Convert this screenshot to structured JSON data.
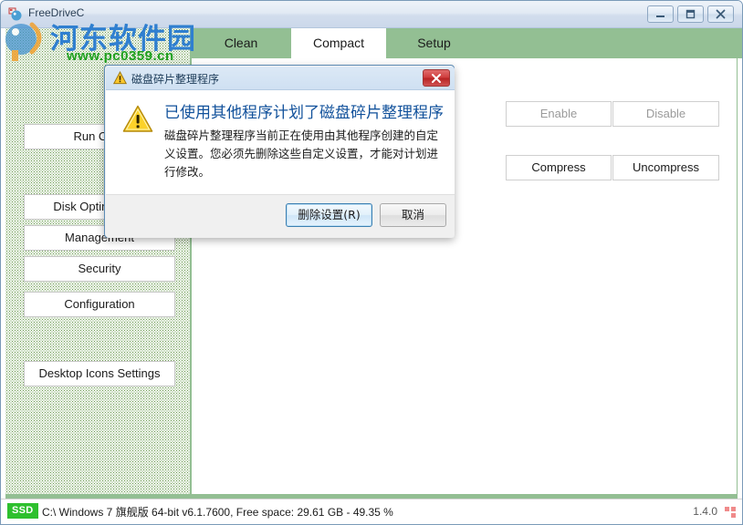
{
  "window": {
    "title": "FreeDriveC",
    "icon": "app-icon",
    "controls": {
      "minimize": "Minimize",
      "maximize": "Maximize",
      "close": "Close"
    }
  },
  "watermark": {
    "chinese": "河东软件园",
    "url": "www.pc0359.cn",
    "chinese_color": "#2f7fd0",
    "url_color": "#1ea01e"
  },
  "tabs": [
    {
      "label": "Clean",
      "active": false
    },
    {
      "label": "Compact",
      "active": true
    },
    {
      "label": "Setup",
      "active": false
    }
  ],
  "sidebar": {
    "items": [
      {
        "label": "Run CMD"
      },
      {
        "label": "Disk Optimization"
      },
      {
        "label": "Management"
      },
      {
        "label": "Security"
      },
      {
        "label": "Configuration"
      },
      {
        "label": "Desktop Icons Settings"
      }
    ]
  },
  "main": {
    "buttons": [
      {
        "label": "Enable",
        "state": "disabled"
      },
      {
        "label": "Disable",
        "state": "disabled"
      },
      {
        "label": "Compress",
        "state": "enabled"
      },
      {
        "label": "Uncompress",
        "state": "enabled"
      }
    ]
  },
  "dialog": {
    "title": "磁盘碎片整理程序",
    "title_icon": "warning-icon",
    "heading": "已使用其他程序计划了磁盘碎片整理程序",
    "message": "磁盘碎片整理程序当前正在使用由其他程序创建的自定义设置。您必须先删除这些自定义设置，才能对计划进行修改。",
    "buttons": {
      "primary": "删除设置(R)",
      "cancel": "取消"
    },
    "close_label": "关闭"
  },
  "status_bar": {
    "badge": "SSD",
    "badge_color": "#2ec02e",
    "text": "C:\\ Windows 7 旗舰版  64-bit v6.1.7600, Free space: 29.61 GB - 49.35 %",
    "version": "1.4.0"
  }
}
